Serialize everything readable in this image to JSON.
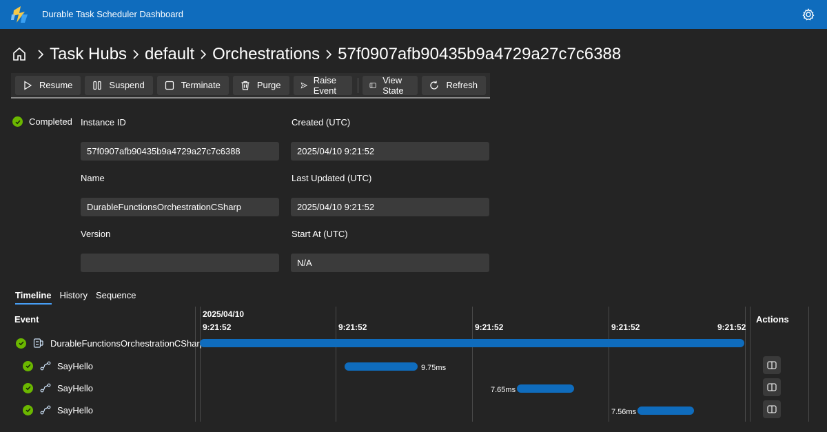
{
  "app": {
    "title": "Durable Task Scheduler Dashboard"
  },
  "breadcrumb": [
    "Task Hubs",
    "default",
    "Orchestrations",
    "57f0907afb90435b9a4729a27c7c6388"
  ],
  "toolbar": {
    "resume": "Resume",
    "suspend": "Suspend",
    "terminate": "Terminate",
    "purge": "Purge",
    "raise_event": "Raise Event",
    "view_state": "View State",
    "refresh": "Refresh"
  },
  "status": {
    "label": "Completed",
    "color": "#6bb700"
  },
  "details": {
    "instance_id": {
      "label": "Instance ID",
      "value": "57f0907afb90435b9a4729a27c7c6388"
    },
    "name": {
      "label": "Name",
      "value": "DurableFunctionsOrchestrationCSharp"
    },
    "version": {
      "label": "Version",
      "value": ""
    },
    "created": {
      "label": "Created (UTC)",
      "value": "2025/04/10 9:21:52"
    },
    "last_updated": {
      "label": "Last Updated (UTC)",
      "value": "2025/04/10 9:21:52"
    },
    "start_at": {
      "label": "Start At (UTC)",
      "value": "N/A"
    }
  },
  "tabs": [
    "Timeline",
    "History",
    "Sequence"
  ],
  "timeline": {
    "event_header": "Event",
    "actions_header": "Actions",
    "date_label": "2025/04/10",
    "ticks": [
      "9:21:52",
      "9:21:52",
      "9:21:52",
      "9:21:52",
      "9:21:52"
    ],
    "rows": [
      {
        "name": "DurableFunctionsOrchestrationCSharp",
        "icon": "orchestration-icon"
      },
      {
        "name": "SayHello",
        "icon": "activity-icon",
        "duration": "9.75ms"
      },
      {
        "name": "SayHello",
        "icon": "activity-icon",
        "duration": "7.65ms"
      },
      {
        "name": "SayHello",
        "icon": "activity-icon",
        "duration": "7.56ms"
      }
    ],
    "bar_color": "#0f6cbd"
  }
}
